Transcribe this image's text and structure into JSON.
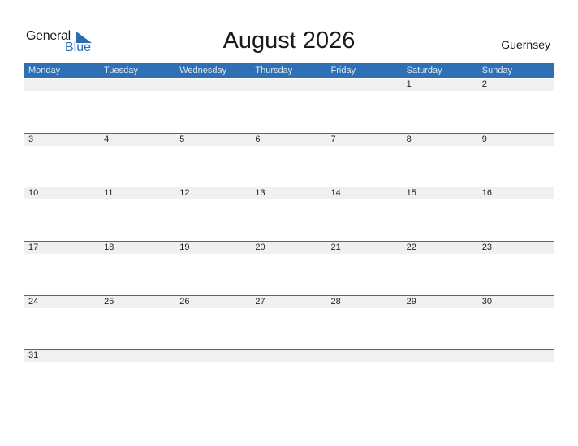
{
  "logo": {
    "general": "General",
    "blue": "Blue",
    "icon": "triangle-flag-icon"
  },
  "title": "August 2026",
  "country": "Guernsey",
  "colors": {
    "header": "#2e70b3",
    "strip": "#f0f0f0",
    "brand": "#2a6db3"
  },
  "weekdays": [
    "Monday",
    "Tuesday",
    "Wednesday",
    "Thursday",
    "Friday",
    "Saturday",
    "Sunday"
  ],
  "weeks": [
    [
      "",
      "",
      "",
      "",
      "",
      "1",
      "2"
    ],
    [
      "3",
      "4",
      "5",
      "6",
      "7",
      "8",
      "9"
    ],
    [
      "10",
      "11",
      "12",
      "13",
      "14",
      "15",
      "16"
    ],
    [
      "17",
      "18",
      "19",
      "20",
      "21",
      "22",
      "23"
    ],
    [
      "24",
      "25",
      "26",
      "27",
      "28",
      "29",
      "30"
    ],
    [
      "31",
      "",
      "",
      "",
      "",
      "",
      ""
    ]
  ]
}
